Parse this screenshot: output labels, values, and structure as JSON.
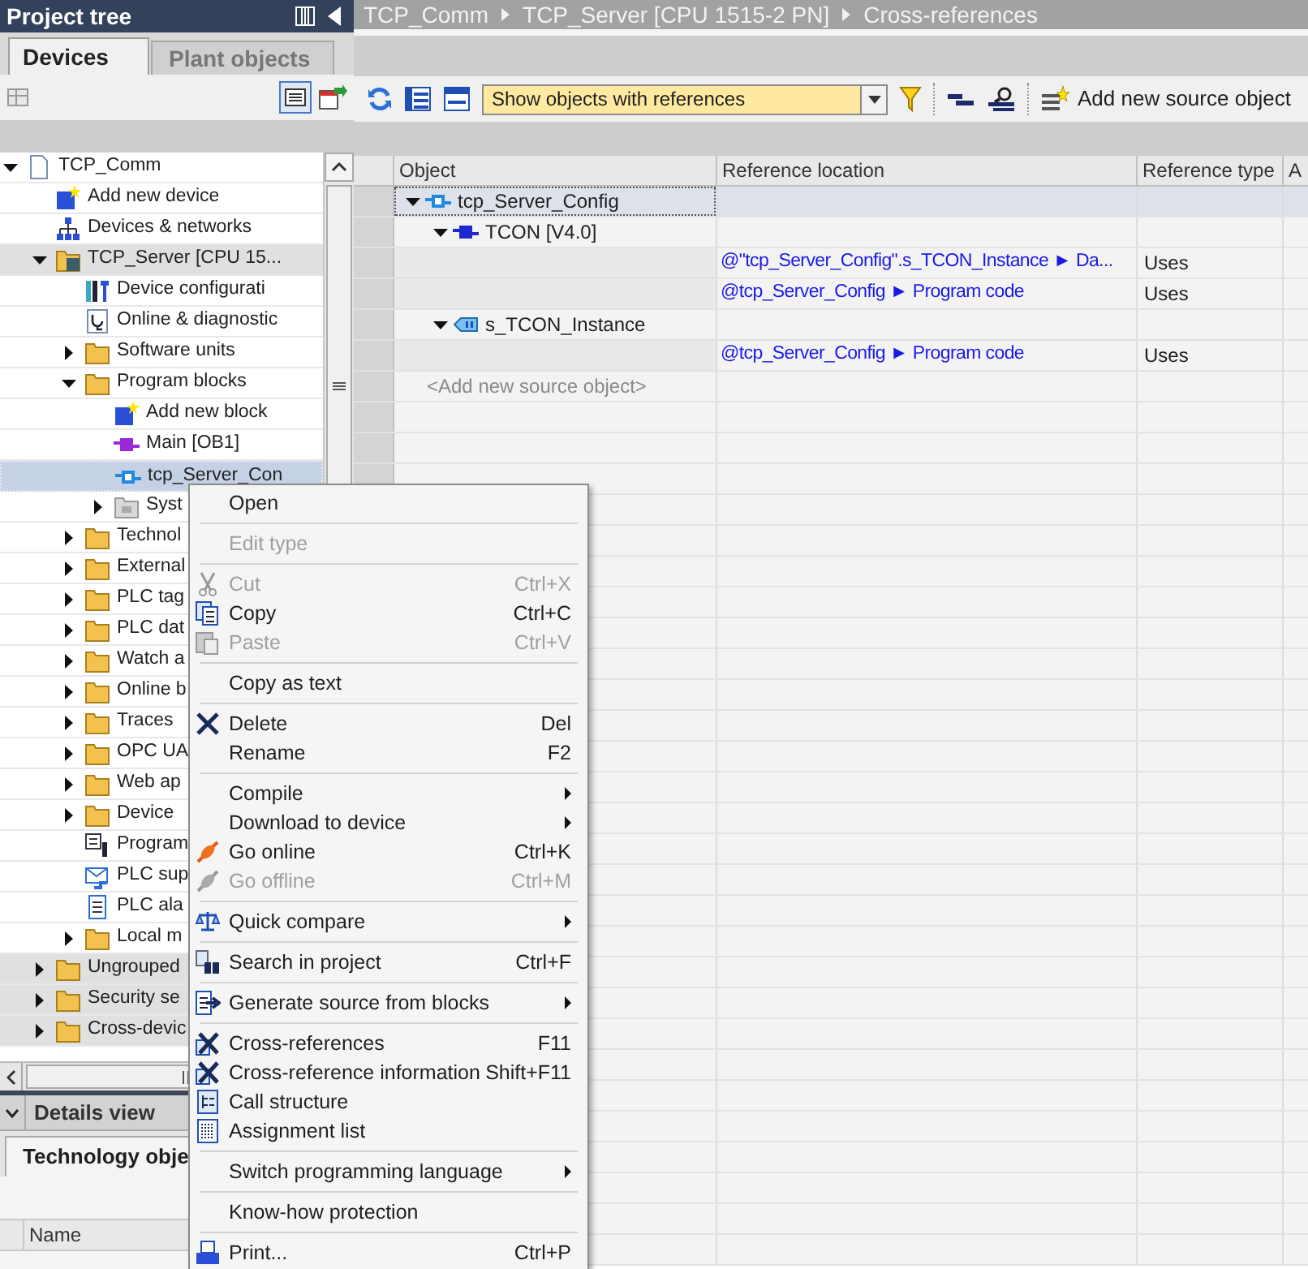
{
  "project_tree": {
    "title": "Project tree",
    "tabs": [
      {
        "label": "Devices",
        "selected": true
      },
      {
        "label": "Plant objects",
        "selected": false
      }
    ],
    "items": [
      {
        "label": "TCP_Comm",
        "kind": "project",
        "expanded": true,
        "selected": false,
        "emphasized": false,
        "children": [
          {
            "label": "Add new device",
            "kind": "add",
            "selected": false,
            "emphasized": false
          },
          {
            "label": "Devices & networks",
            "kind": "network",
            "selected": false,
            "emphasized": false
          },
          {
            "label": "TCP_Server [CPU 15...",
            "kind": "device",
            "expanded": true,
            "selected": false,
            "emphasized": true,
            "children": [
              {
                "label": "Device configurati",
                "kind": "config",
                "selected": false,
                "emphasized": false
              },
              {
                "label": "Online & diagnostic",
                "kind": "diag",
                "selected": false,
                "emphasized": false
              },
              {
                "label": "Software units",
                "kind": "folder",
                "expanded": false,
                "selected": false,
                "emphasized": false
              },
              {
                "label": "Program blocks",
                "kind": "folder",
                "expanded": true,
                "selected": false,
                "emphasized": false,
                "children": [
                  {
                    "label": "Add new block",
                    "kind": "add",
                    "selected": false,
                    "emphasized": false
                  },
                  {
                    "label": "Main [OB1]",
                    "kind": "ob",
                    "selected": false,
                    "emphasized": false
                  },
                  {
                    "label": "tcp_Server_Con",
                    "kind": "fb",
                    "selected": true,
                    "emphasized": false
                  },
                  {
                    "label": "Syst",
                    "kind": "system",
                    "expanded": false,
                    "selected": false,
                    "emphasized": false
                  }
                ]
              },
              {
                "label": "Technol",
                "kind": "folder",
                "expanded": false,
                "selected": false,
                "emphasized": false
              },
              {
                "label": "External",
                "kind": "folder",
                "expanded": false,
                "selected": false,
                "emphasized": false
              },
              {
                "label": "PLC tag",
                "kind": "folder",
                "expanded": false,
                "selected": false,
                "emphasized": false
              },
              {
                "label": "PLC dat",
                "kind": "folder",
                "expanded": false,
                "selected": false,
                "emphasized": false
              },
              {
                "label": "Watch a",
                "kind": "folder",
                "expanded": false,
                "selected": false,
                "emphasized": false
              },
              {
                "label": "Online b",
                "kind": "folder",
                "expanded": false,
                "selected": false,
                "emphasized": false
              },
              {
                "label": "Traces",
                "kind": "folder",
                "expanded": false,
                "selected": false,
                "emphasized": false
              },
              {
                "label": "OPC UA",
                "kind": "folder",
                "expanded": false,
                "selected": false,
                "emphasized": false
              },
              {
                "label": "Web ap",
                "kind": "folder",
                "expanded": false,
                "selected": false,
                "emphasized": false
              },
              {
                "label": "Device",
                "kind": "folder",
                "expanded": false,
                "selected": false,
                "emphasized": false
              },
              {
                "label": "Program",
                "kind": "info",
                "selected": false,
                "emphasized": false
              },
              {
                "label": "PLC sup",
                "kind": "mail",
                "selected": false,
                "emphasized": false
              },
              {
                "label": "PLC ala",
                "kind": "page",
                "selected": false,
                "emphasized": false
              },
              {
                "label": "Local m",
                "kind": "folder",
                "expanded": false,
                "selected": false,
                "emphasized": false
              }
            ]
          },
          {
            "label": "Ungrouped",
            "kind": "folder",
            "expanded": false,
            "selected": false,
            "emphasized": true
          },
          {
            "label": "Security se",
            "kind": "folder",
            "expanded": false,
            "selected": false,
            "emphasized": true
          },
          {
            "label": "Cross-devic",
            "kind": "folder",
            "expanded": false,
            "selected": false,
            "emphasized": true
          }
        ]
      }
    ]
  },
  "details_view": {
    "title": "Details view",
    "tab": "Technology obje",
    "column": "Name"
  },
  "breadcrumb": [
    "TCP_Comm",
    "TCP_Server [CPU 1515-2 PN]",
    "Cross-references"
  ],
  "toolbar": {
    "filter": "Show objects with references",
    "add_button": "Add new source object"
  },
  "table": {
    "columns": [
      "Object",
      "Reference location",
      "Reference type",
      "A"
    ],
    "objects": [
      {
        "name": "tcp_Server_Config",
        "kind": "fb",
        "expanded": true,
        "selected": true,
        "children": [
          {
            "name": "TCON [V4.0]",
            "kind": "block",
            "expanded": true,
            "selected": false,
            "references": [
              {
                "location": "@\"tcp_Server_Config\".s_TCON_Instance ► Da...",
                "type": "Uses"
              },
              {
                "location": "@tcp_Server_Config ► Program code",
                "type": "Uses"
              }
            ]
          },
          {
            "name": "s_TCON_Instance",
            "kind": "instance",
            "expanded": true,
            "selected": false,
            "references": [
              {
                "location": "@tcp_Server_Config ► Program code",
                "type": "Uses"
              }
            ]
          }
        ]
      }
    ],
    "add_row": "<Add new source object>"
  },
  "context_menu": {
    "groups": [
      [
        {
          "label": "Open",
          "kind": "plain",
          "disabled": false
        }
      ],
      [
        {
          "label": "Edit type",
          "kind": "plain",
          "disabled": true
        }
      ],
      [
        {
          "label": "Cut",
          "kind": "cut",
          "shortcut": "Ctrl+X",
          "disabled": true
        },
        {
          "label": "Copy",
          "kind": "copy",
          "shortcut": "Ctrl+C",
          "disabled": false
        },
        {
          "label": "Paste",
          "kind": "paste",
          "shortcut": "Ctrl+V",
          "disabled": true
        }
      ],
      [
        {
          "label": "Copy as text",
          "kind": "plain",
          "disabled": false
        }
      ],
      [
        {
          "label": "Delete",
          "kind": "delete",
          "shortcut": "Del",
          "disabled": false
        },
        {
          "label": "Rename",
          "kind": "plain",
          "shortcut": "F2",
          "disabled": false
        }
      ],
      [
        {
          "label": "Compile",
          "kind": "plain",
          "submenu": true,
          "disabled": false
        },
        {
          "label": "Download to device",
          "kind": "plain",
          "submenu": true,
          "disabled": false
        },
        {
          "label": "Go online",
          "kind": "online",
          "shortcut": "Ctrl+K",
          "disabled": false
        },
        {
          "label": "Go offline",
          "kind": "offline",
          "shortcut": "Ctrl+M",
          "disabled": true
        }
      ],
      [
        {
          "label": "Quick compare",
          "kind": "compare",
          "submenu": true,
          "disabled": false
        }
      ],
      [
        {
          "label": "Search in project",
          "kind": "search",
          "shortcut": "Ctrl+F",
          "disabled": false
        }
      ],
      [
        {
          "label": "Generate source from blocks",
          "kind": "generate",
          "submenu": true,
          "disabled": false
        }
      ],
      [
        {
          "label": "Cross-references",
          "kind": "xref",
          "shortcut": "F11",
          "disabled": false
        },
        {
          "label": "Cross-reference information",
          "kind": "xref",
          "shortcut": "Shift+F11",
          "disabled": false
        },
        {
          "label": "Call structure",
          "kind": "call",
          "disabled": false
        },
        {
          "label": "Assignment list",
          "kind": "assign",
          "disabled": false
        }
      ],
      [
        {
          "label": "Switch programming language",
          "kind": "plain",
          "submenu": true,
          "disabled": false
        }
      ],
      [
        {
          "label": "Know-how protection",
          "kind": "plain",
          "disabled": false
        }
      ],
      [
        {
          "label": "Print...",
          "kind": "print",
          "shortcut": "Ctrl+P",
          "disabled": false
        }
      ]
    ]
  }
}
